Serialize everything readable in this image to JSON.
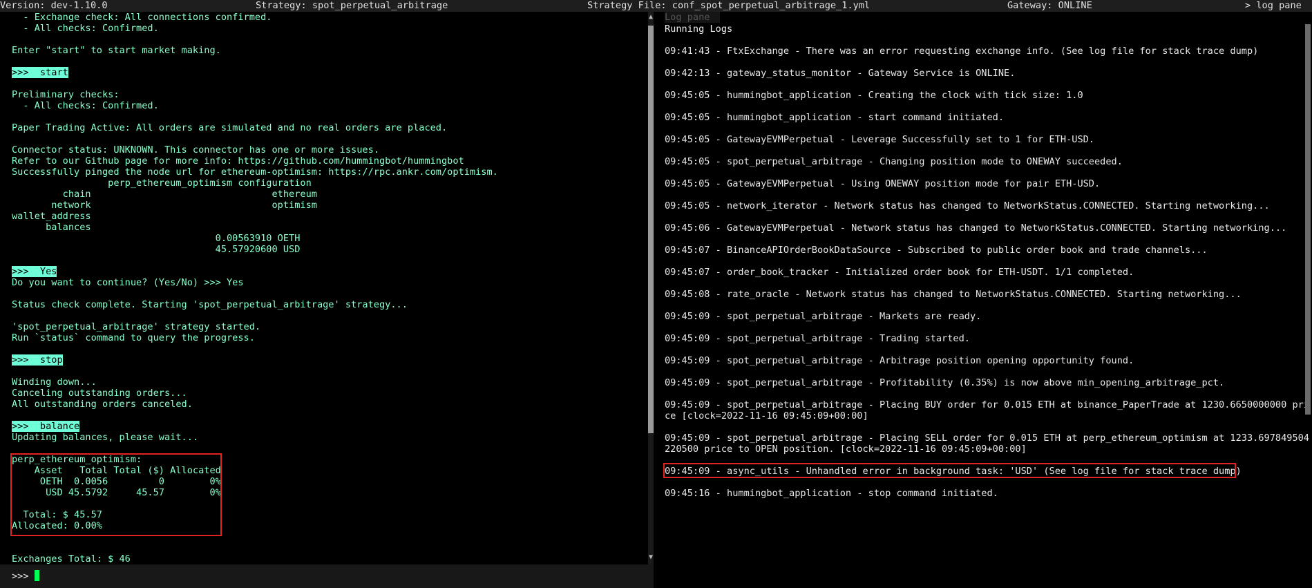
{
  "status_bar": {
    "version": "Version: dev-1.10.0",
    "strategy": "Strategy: spot_perpetual_arbitrage",
    "strategy_file": "Strategy File: conf_spot_perpetual_arbitrage_1.yml",
    "gateway": "Gateway: ONLINE",
    "log_pane_toggle": "> log pane"
  },
  "output_pane": {
    "lines": [
      {
        "text": "  - Exchange check: All connections confirmed."
      },
      {
        "text": "  - All checks: Confirmed."
      },
      {
        "text": ""
      },
      {
        "text": "Enter \"start\" to start market making."
      },
      {
        "text": ""
      },
      {
        "text": ">>>  start",
        "cmd": true
      },
      {
        "text": ""
      },
      {
        "text": "Preliminary checks:"
      },
      {
        "text": "  - All checks: Confirmed."
      },
      {
        "text": ""
      },
      {
        "text": "Paper Trading Active: All orders are simulated and no real orders are placed."
      },
      {
        "text": ""
      },
      {
        "text": "Connector status: UNKNOWN. This connector has one or more issues."
      },
      {
        "text": "Refer to our Github page for more info: https://github.com/hummingbot/hummingbot"
      },
      {
        "text": "Successfully pinged the node url for ethereum-optimism: https://rpc.ankr.com/optimism."
      },
      {
        "text": "                 perp_ethereum_optimism configuration"
      },
      {
        "text": "         chain                                ethereum"
      },
      {
        "text": "       network                                optimism"
      },
      {
        "text": "wallet_address"
      },
      {
        "text": "      balances"
      },
      {
        "text": "                                    0.00563910 OETH"
      },
      {
        "text": "                                    45.57920600 USD"
      },
      {
        "text": ""
      },
      {
        "text": ">>>  Yes",
        "cmd": true
      },
      {
        "text": "Do you want to continue? (Yes/No) >>> Yes"
      },
      {
        "text": ""
      },
      {
        "text": "Status check complete. Starting 'spot_perpetual_arbitrage' strategy..."
      },
      {
        "text": ""
      },
      {
        "text": "'spot_perpetual_arbitrage' strategy started."
      },
      {
        "text": "Run `status` command to query the progress."
      },
      {
        "text": ""
      },
      {
        "text": ">>>  stop",
        "cmd": true
      },
      {
        "text": ""
      },
      {
        "text": "Winding down..."
      },
      {
        "text": "Canceling outstanding orders..."
      },
      {
        "text": "All outstanding orders canceled."
      },
      {
        "text": ""
      },
      {
        "text": ">>>  balance",
        "cmd": true
      },
      {
        "text": "Updating balances, please wait..."
      },
      {
        "text": ""
      },
      {
        "text": "perp_ethereum_optimism:"
      },
      {
        "text": "    Asset   Total Total ($) Allocated"
      },
      {
        "text": "     OETH  0.0056         0        0%"
      },
      {
        "text": "      USD 45.5792     45.57        0%"
      },
      {
        "text": ""
      },
      {
        "text": "  Total: $ 45.57"
      },
      {
        "text": "Allocated: 0.00%"
      },
      {
        "text": ""
      },
      {
        "text": ""
      },
      {
        "text": "Exchanges Total: $ 46"
      }
    ]
  },
  "input": {
    "prompt": ">>> "
  },
  "log_pane": {
    "header": "Log pane",
    "title": "Running Logs",
    "entries": [
      "09:41:43 - FtxExchange - There was an error requesting exchange info. (See log file for stack trace dump)",
      "09:42:13 - gateway_status_monitor - Gateway Service is ONLINE.",
      "09:45:05 - hummingbot_application - Creating the clock with tick size: 1.0",
      "09:45:05 - hummingbot_application - start command initiated.",
      "09:45:05 - GatewayEVMPerpetual - Leverage Successfully set to 1 for ETH-USD.",
      "09:45:05 - spot_perpetual_arbitrage - Changing position mode to ONEWAY succeeded.",
      "09:45:05 - GatewayEVMPerpetual - Using ONEWAY position mode for pair ETH-USD.",
      "09:45:05 - network_iterator - Network status has changed to NetworkStatus.CONNECTED. Starting networking...",
      "09:45:06 - GatewayEVMPerpetual - Network status has changed to NetworkStatus.CONNECTED. Starting networking...",
      "09:45:07 - BinanceAPIOrderBookDataSource - Subscribed to public order book and trade channels...",
      "09:45:07 - order_book_tracker - Initialized order book for ETH-USDT. 1/1 completed.",
      "09:45:08 - rate_oracle - Network status has changed to NetworkStatus.CONNECTED. Starting networking...",
      "09:45:09 - spot_perpetual_arbitrage - Markets are ready.",
      "09:45:09 - spot_perpetual_arbitrage - Trading started.",
      "09:45:09 - spot_perpetual_arbitrage - Arbitrage position opening opportunity found.",
      "09:45:09 - spot_perpetual_arbitrage - Profitability (0.35%) is now above min_opening_arbitrage_pct.",
      "09:45:09 - spot_perpetual_arbitrage - Placing BUY order for 0.015 ETH at binance_PaperTrade at 1230.6650000000 pri\nce [clock=2022-11-16 09:45:09+00:00]",
      "09:45:09 - spot_perpetual_arbitrage - Placing SELL order for 0.015 ETH at perp_ethereum_optimism at 1233.697849504\n220500 price to OPEN position. [clock=2022-11-16 09:45:09+00:00]",
      "09:45:09 - async_utils - Unhandled error in background task: 'USD' (See log file for stack trace dump)",
      "09:45:16 - hummingbot_application - stop command initiated."
    ]
  },
  "colors": {
    "output_text": "#88ffcc",
    "command_highlight": "#6fffd8",
    "cursor": "#00ff55",
    "highlight_box": "#e32222"
  }
}
